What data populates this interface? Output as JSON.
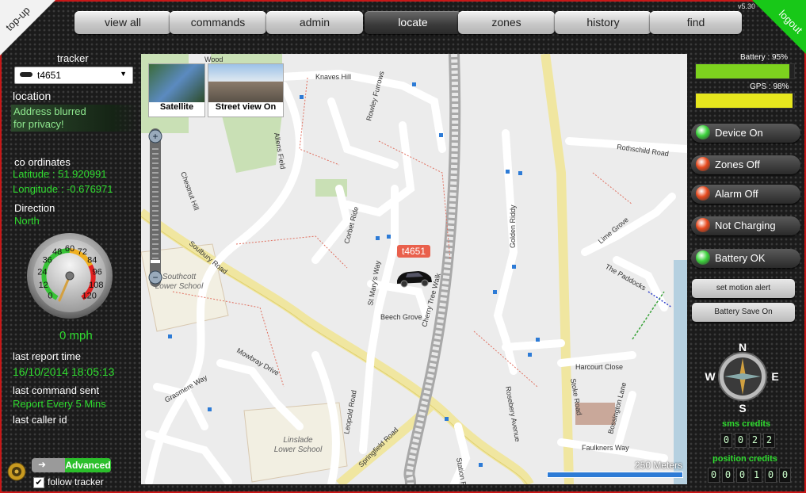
{
  "nav": {
    "topup_label": "top-up",
    "logout_label": "logout",
    "version": "v5.30",
    "items": [
      {
        "label": "view all",
        "active": false
      },
      {
        "label": "commands",
        "active": false
      },
      {
        "label": "admin",
        "active": false
      },
      {
        "label": "locate",
        "active": true
      },
      {
        "label": "zones",
        "active": false
      },
      {
        "label": "history",
        "active": false
      },
      {
        "label": "find",
        "active": false
      }
    ]
  },
  "left": {
    "tracker_label": "tracker",
    "tracker_selected": "t4651",
    "location_label": "location",
    "address_line1": "Address blurred",
    "address_line2": "for privacy!",
    "coords_label": "co ordinates",
    "latitude": "Latitude : 51.920991",
    "longitude": "Longitude : -0.676971",
    "direction_label": "Direction",
    "direction_value": "North",
    "speedometer_ticks": [
      "0",
      "12",
      "24",
      "36",
      "48",
      "60",
      "72",
      "84",
      "96",
      "108",
      "120"
    ],
    "speed_value": 0,
    "speed_text": "0 mph",
    "last_report_label": "last report time",
    "last_report_value": "16/10/2014 18:05:13",
    "last_command_label": "last command sent",
    "last_command_value": "Report Every 5 Mins",
    "last_caller_label": "last caller id",
    "advanced_label": "Advanced",
    "follow_label": "follow tracker",
    "follow_checked": true
  },
  "map": {
    "satellite_label": "Satellite",
    "streetview_label": "Street view On",
    "tracker_marker_label": "t4651",
    "scale_label": "250 Meters",
    "roads": [
      "Knaves Hill",
      "Rowley Furrows",
      "Allens Field",
      "Chestnut Hill",
      "Soulbury Road",
      "Corbet Ride",
      "St Mary's Way",
      "Cherry Tree Walk",
      "Beech Grove",
      "Golden Riddy",
      "Rothschild Road",
      "Lime Grove",
      "The Paddocks",
      "Bossington Lane",
      "Stoke Road",
      "Rosebery Avenue",
      "Harcourt Close",
      "Mowbray Drive",
      "Grasmere Way",
      "Leopold Road",
      "Springfield Road",
      "Station Road",
      "Faulkners Way",
      "Wood"
    ],
    "places": [
      "Southcott Lower School",
      "Linslade Lower School"
    ]
  },
  "right": {
    "battery_label": "Battery : 95%",
    "battery_level": 95,
    "gps_label": "GPS : 98%",
    "gps_level": 98,
    "statuses": [
      {
        "label": "Device On",
        "color": "#3cd23c"
      },
      {
        "label": "Zones Off",
        "color": "#e84a1e"
      },
      {
        "label": "Alarm Off",
        "color": "#e84a1e"
      },
      {
        "label": "Not Charging",
        "color": "#e84a1e"
      },
      {
        "label": "Battery OK",
        "color": "#3cd23c"
      }
    ],
    "motion_alert_label": "set motion alert",
    "battery_save_label": "Battery Save On",
    "compass": {
      "n": "N",
      "e": "E",
      "s": "S",
      "w": "W"
    },
    "sms_credits_label": "sms credits",
    "sms_credits_digits": [
      "0",
      "0",
      "2",
      "2"
    ],
    "position_credits_label": "position credits",
    "position_credits_digits": [
      "0",
      "0",
      "0",
      "1",
      "0",
      "0"
    ]
  },
  "colors": {
    "battery": "#7dd21e",
    "gps": "#e6e61e",
    "green_text": "#2fdc2f",
    "frame": "#c81818"
  }
}
